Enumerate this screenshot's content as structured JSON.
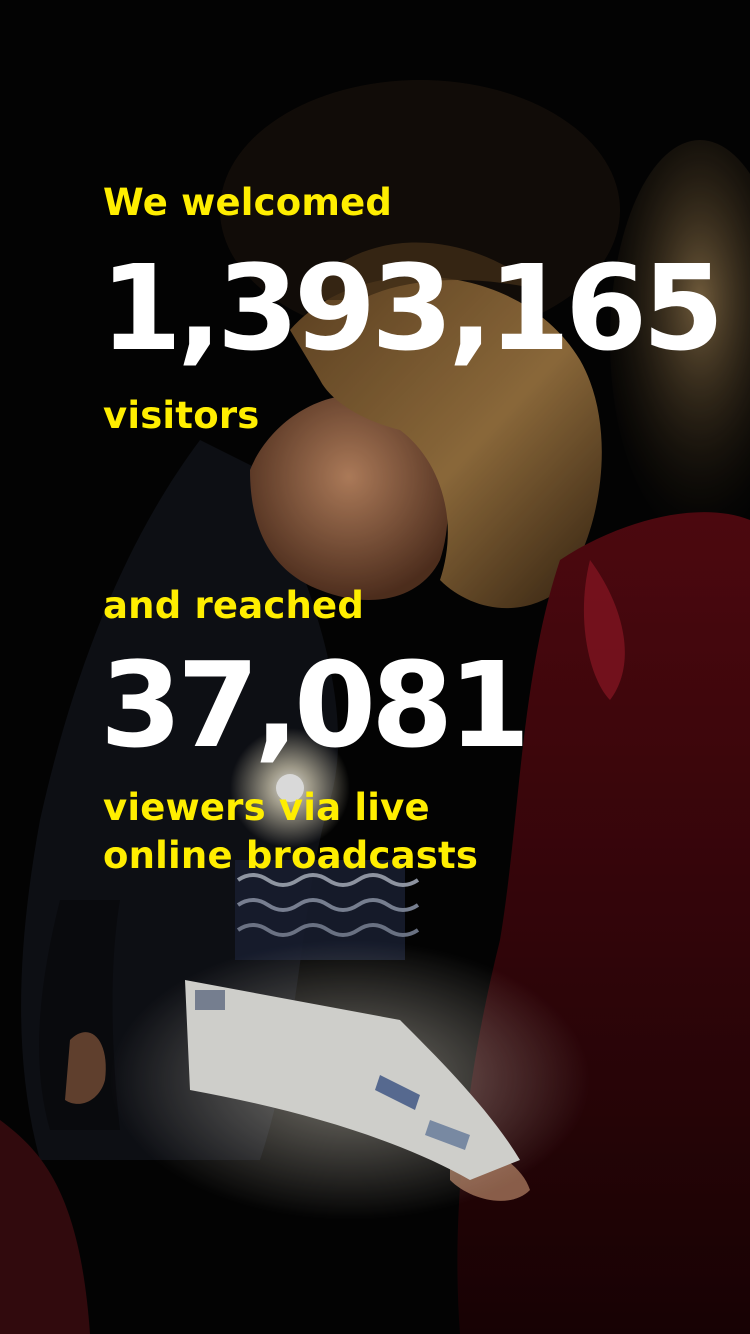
{
  "stats": {
    "visitors_lead": "We welcomed",
    "visitors_number": "1,393,165",
    "visitors_unit": "visitors",
    "viewers_lead": "and reached",
    "viewers_number": "37,081",
    "viewers_unit_line1": "viewers via live",
    "viewers_unit_line2": "online broadcasts"
  },
  "colors": {
    "background": "#000000",
    "accent_yellow": "#ffee00",
    "number_white": "#ffffff"
  }
}
